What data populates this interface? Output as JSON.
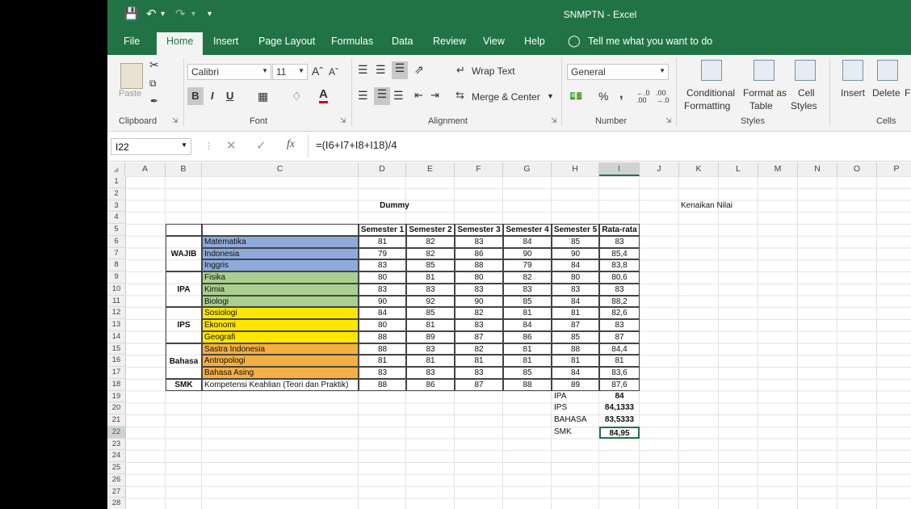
{
  "window": {
    "title": "SNMPTN  -  Excel"
  },
  "tabs": {
    "file": "File",
    "home": "Home",
    "insert": "Insert",
    "page_layout": "Page Layout",
    "formulas": "Formulas",
    "data": "Data",
    "review": "Review",
    "view": "View",
    "help": "Help",
    "tell_me": "Tell me what you want to do"
  },
  "ribbon": {
    "clipboard": {
      "label": "Clipboard",
      "paste": "Paste"
    },
    "font": {
      "label": "Font",
      "name": "Calibri",
      "size": "11",
      "bold": "B",
      "italic": "I",
      "underline": "U"
    },
    "alignment": {
      "label": "Alignment",
      "wrap": "Wrap Text",
      "merge": "Merge & Center"
    },
    "number": {
      "label": "Number",
      "format": "General",
      "percent": "%",
      "comma": ","
    },
    "styles": {
      "label": "Styles",
      "conditional": "Conditional",
      "conditional2": "Formatting",
      "format_as": "Format as",
      "format_as2": "Table",
      "cell": "Cell",
      "cell2": "Styles"
    },
    "cells": {
      "label": "Cells",
      "insert": "Insert",
      "delete": "Delete",
      "format": "F"
    }
  },
  "formula_bar": {
    "name_box": "I22",
    "fx": "fx",
    "formula": "=(I6+I7+I8+I18)/4"
  },
  "columns": [
    "A",
    "B",
    "C",
    "D",
    "E",
    "F",
    "G",
    "H",
    "I",
    "J",
    "K",
    "L",
    "M",
    "N",
    "O",
    "P"
  ],
  "rows": [
    "1",
    "2",
    "3",
    "4",
    "5",
    "6",
    "7",
    "8",
    "9",
    "10",
    "11",
    "12",
    "13",
    "14",
    "15",
    "16",
    "17",
    "18",
    "19",
    "20",
    "21",
    "22",
    "23",
    "24",
    "25",
    "26",
    "27",
    "28"
  ],
  "sheet": {
    "title": "Dummy",
    "note": "Kenaikan Nilai",
    "headers": [
      "Semester 1",
      "Semester 2",
      "Semester 3",
      "Semester 4",
      "Semester 5",
      "Rata-rata"
    ],
    "groups": [
      {
        "name": "WAJIB",
        "color": "#8eaadb",
        "subjects": [
          {
            "name": "Matematika",
            "values": [
              "81",
              "82",
              "83",
              "84",
              "85",
              "83"
            ]
          },
          {
            "name": "Indonesia",
            "values": [
              "79",
              "82",
              "86",
              "90",
              "90",
              "85,4"
            ]
          },
          {
            "name": "Inggris",
            "values": [
              "83",
              "85",
              "88",
              "79",
              "84",
              "83,8"
            ]
          }
        ]
      },
      {
        "name": "IPA",
        "color": "#a9d08e",
        "subjects": [
          {
            "name": "Fisika",
            "values": [
              "80",
              "81",
              "80",
              "82",
              "80",
              "80,6"
            ]
          },
          {
            "name": "Kimia",
            "values": [
              "83",
              "83",
              "83",
              "83",
              "83",
              "83"
            ]
          },
          {
            "name": "Biologi",
            "values": [
              "90",
              "92",
              "90",
              "85",
              "84",
              "88,2"
            ]
          }
        ]
      },
      {
        "name": "IPS",
        "color": "#ffe600",
        "subjects": [
          {
            "name": "Sosiologi",
            "values": [
              "84",
              "85",
              "82",
              "81",
              "81",
              "82,6"
            ]
          },
          {
            "name": "Ekonomi",
            "values": [
              "80",
              "81",
              "83",
              "84",
              "87",
              "83"
            ]
          },
          {
            "name": "Geografi",
            "values": [
              "88",
              "89",
              "87",
              "86",
              "85",
              "87"
            ]
          }
        ]
      },
      {
        "name": "Bahasa",
        "color": "#f4b042",
        "subjects": [
          {
            "name": "Sastra Indonesia",
            "values": [
              "88",
              "83",
              "82",
              "81",
              "88",
              "84,4"
            ]
          },
          {
            "name": "Antropologi",
            "values": [
              "81",
              "81",
              "81",
              "81",
              "81",
              "81"
            ]
          },
          {
            "name": "Bahasa Asing",
            "values": [
              "83",
              "83",
              "83",
              "85",
              "84",
              "83,6"
            ]
          }
        ]
      },
      {
        "name": "SMK",
        "color": "#ffffff",
        "subjects": [
          {
            "name": "Kompetensi Keahlian (Teori dan Praktik)",
            "values": [
              "88",
              "86",
              "87",
              "88",
              "89",
              "87,6"
            ]
          }
        ]
      }
    ],
    "summary": [
      {
        "label": "IPA",
        "value": "84"
      },
      {
        "label": "IPS",
        "value": "84,1333"
      },
      {
        "label": "BAHASA",
        "value": "83,5333"
      },
      {
        "label": "SMK",
        "value": "84,95"
      }
    ]
  }
}
